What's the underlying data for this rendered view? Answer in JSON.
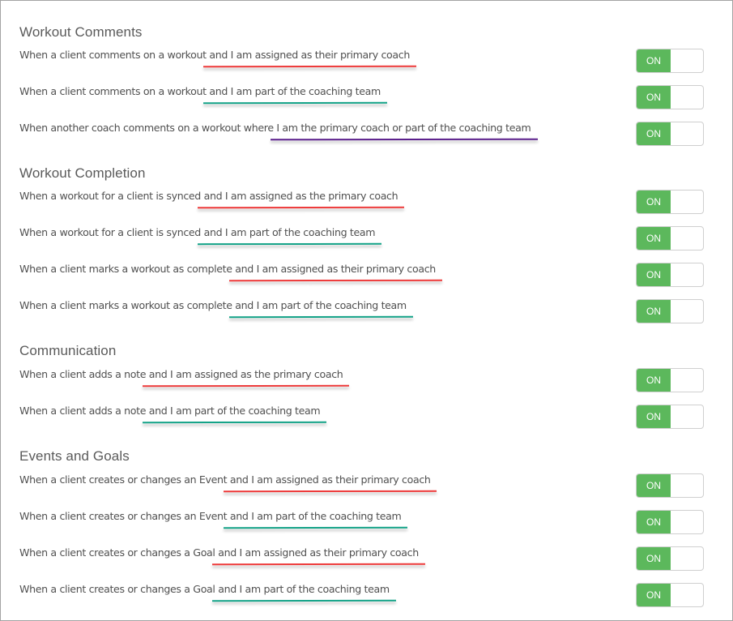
{
  "sections": [
    {
      "title": "Workout Comments",
      "rows": [
        {
          "prefix": "When a client comments on a workout",
          "highlight": " and I am assigned as their primary coach",
          "color": "red",
          "toggle": "ON"
        },
        {
          "prefix": "When a client comments on a workout",
          "highlight": " and I am part of the coaching team",
          "color": "teal",
          "toggle": "ON"
        },
        {
          "prefix": "When another coach comments on a workout where",
          "highlight": " I am the primary coach or part of the coaching team",
          "color": "purple",
          "toggle": "ON"
        }
      ]
    },
    {
      "title": "Workout Completion",
      "rows": [
        {
          "prefix": "When a workout for a client is synced",
          "highlight": " and I am assigned as the primary coach",
          "color": "red",
          "toggle": "ON"
        },
        {
          "prefix": "When a workout for a client is synced",
          "highlight": " and I am part of the coaching team",
          "color": "teal",
          "toggle": "ON"
        },
        {
          "prefix": "When a client marks a workout as complete",
          "highlight": " and I am assigned as their primary coach",
          "color": "red",
          "toggle": "ON"
        },
        {
          "prefix": "When a client marks a workout as complete",
          "highlight": " and I am part of the coaching team",
          "color": "teal",
          "toggle": "ON"
        }
      ]
    },
    {
      "title": "Communication",
      "rows": [
        {
          "prefix": "When a client adds a note",
          "highlight": " and I am assigned as the primary coach",
          "color": "red",
          "toggle": "ON"
        },
        {
          "prefix": "When a client adds a note",
          "highlight": " and I am part of the coaching team",
          "color": "teal",
          "toggle": "ON"
        }
      ]
    },
    {
      "title": "Events and Goals",
      "rows": [
        {
          "prefix": "When a client creates or changes an Event",
          "highlight": " and I am assigned as their primary coach",
          "color": "red",
          "toggle": "ON"
        },
        {
          "prefix": "When a client creates or changes an Event",
          "highlight": " and I am part of the coaching team",
          "color": "teal",
          "toggle": "ON"
        },
        {
          "prefix": "When a client creates or changes a Goal",
          "highlight": " and I am assigned as their primary coach",
          "color": "red",
          "toggle": "ON"
        },
        {
          "prefix": "When a client creates or changes a Goal",
          "highlight": " and I am part of the coaching team",
          "color": "teal",
          "toggle": "ON"
        }
      ]
    }
  ],
  "colors": {
    "toggle_on": "#5cb85c",
    "underline_red": "#ee3b3b",
    "underline_teal": "#14a388",
    "underline_purple": "#5b1f8c"
  }
}
